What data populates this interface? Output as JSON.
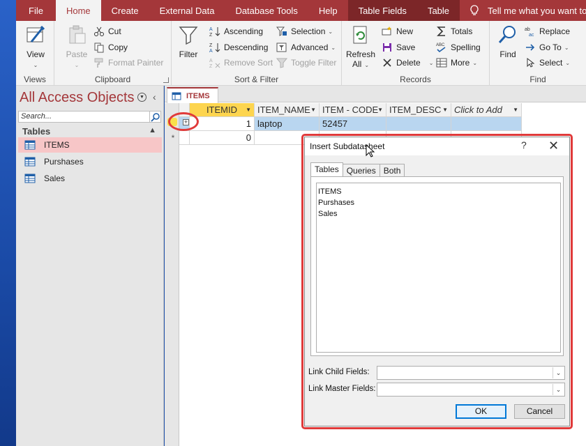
{
  "ribbon_tabs": [
    {
      "label": "File"
    },
    {
      "label": "Home"
    },
    {
      "label": "Create"
    },
    {
      "label": "External Data"
    },
    {
      "label": "Database Tools"
    },
    {
      "label": "Help"
    },
    {
      "label": "Table Fields"
    },
    {
      "label": "Table"
    },
    {
      "label": "Tell me what you want to do"
    }
  ],
  "groups": {
    "views": {
      "label": "Views",
      "view": "View"
    },
    "clipboard": {
      "label": "Clipboard",
      "paste": "Paste",
      "cut": "Cut",
      "copy": "Copy",
      "format_painter": "Format Painter"
    },
    "sort_filter": {
      "label": "Sort & Filter",
      "filter": "Filter",
      "ascending": "Ascending",
      "descending": "Descending",
      "remove_sort": "Remove Sort",
      "selection": "Selection",
      "advanced": "Advanced",
      "toggle_filter": "Toggle Filter"
    },
    "records": {
      "label": "Records",
      "refresh_line1": "Refresh",
      "refresh_line2": "All",
      "new": "New",
      "save": "Save",
      "delete": "Delete",
      "totals": "Totals",
      "spelling": "Spelling",
      "more": "More"
    },
    "find": {
      "label": "Find",
      "find": "Find",
      "replace": "Replace",
      "goto": "Go To",
      "select": "Select"
    }
  },
  "nav": {
    "title": "All Access Objects",
    "search_placeholder": "Search...",
    "section": "Tables",
    "items": [
      {
        "label": "ITEMS"
      },
      {
        "label": "Purshases"
      },
      {
        "label": "Sales"
      }
    ]
  },
  "document": {
    "tab": "ITEMS",
    "columns": [
      {
        "label": "ITEMID"
      },
      {
        "label": "ITEM_NAME"
      },
      {
        "label": "ITEM - CODE"
      },
      {
        "label": "ITEM_DESC"
      },
      {
        "label": "Click to Add"
      }
    ],
    "rows": [
      {
        "itemid": "1",
        "name": "laptop",
        "code": "52457",
        "desc": ""
      },
      {
        "itemid": "0",
        "name": "",
        "code": "",
        "desc": ""
      }
    ],
    "new_row_marker": "*",
    "expander": "+"
  },
  "dialog": {
    "title": "Insert Subdatasheet",
    "help": "?",
    "close": "✕",
    "tabs": [
      {
        "label": "Tables"
      },
      {
        "label": "Queries"
      },
      {
        "label": "Both"
      }
    ],
    "list": [
      {
        "label": "ITEMS"
      },
      {
        "label": "Purshases"
      },
      {
        "label": "Sales"
      }
    ],
    "link_child_label": "Link Child Fields:",
    "link_master_label": "Link Master Fields:",
    "link_child_value": "",
    "link_master_value": "",
    "ok": "OK",
    "cancel": "Cancel"
  },
  "colors": {
    "accent": "#a4373a",
    "highlight": "#e03a3a",
    "selection_row": "#b9d6f0",
    "sorted_header": "#fdd54f"
  }
}
